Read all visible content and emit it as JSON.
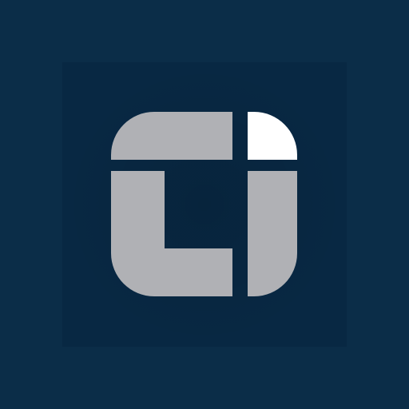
{
  "app_icon": {
    "name": "app-logo",
    "icon": "square-split-logo-icon",
    "colors": {
      "background": "#0b2d48",
      "panel": "#082843",
      "logo_gray": "#b0b1b5",
      "logo_white": "#ffffff"
    }
  }
}
